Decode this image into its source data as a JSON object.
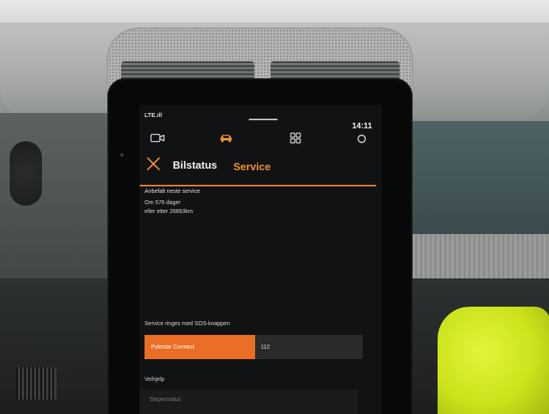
{
  "status_bar": {
    "signal": "LTE.ıll",
    "time": "14:11"
  },
  "nav": {
    "icons": [
      "camera-icon",
      "car-icon",
      "apps-grid-icon",
      "home-circle-icon"
    ],
    "active": "car-icon",
    "accent_color": "#f28f31"
  },
  "header": {
    "title": "Bilstatus",
    "active_tab": "Service"
  },
  "service": {
    "heading": "Anbefalt neste service",
    "line1": "Om 576 dager",
    "line2": "eller etter 26893km"
  },
  "sos": {
    "label": "Service ringes med SOS-knappen",
    "primary_button": "Polestar Connect",
    "secondary_button": "112",
    "primary_color": "#ea6e25"
  },
  "roadside": {
    "label": "Veihjelp",
    "option": "Slepemodus"
  }
}
